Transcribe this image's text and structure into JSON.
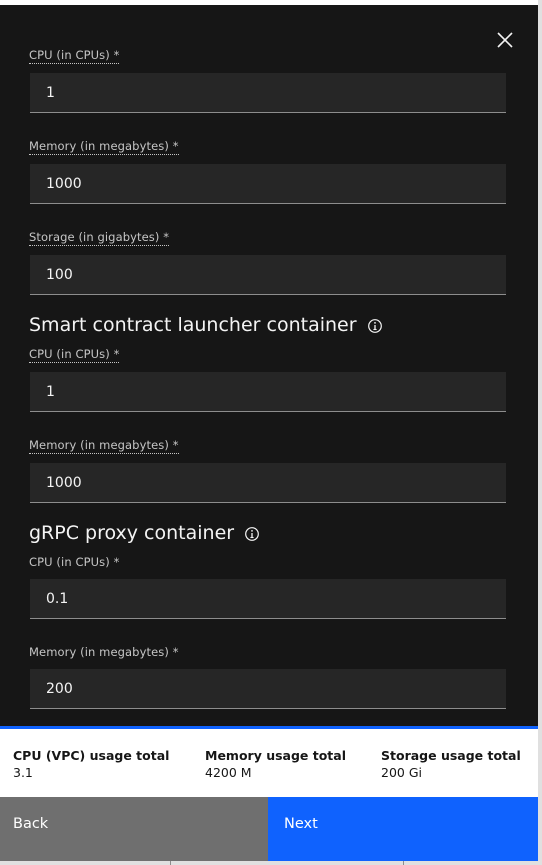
{
  "peer_container": {
    "cpu": {
      "label": "CPU (in CPUs) *",
      "value": "1"
    },
    "memory": {
      "label": "Memory (in megabytes) *",
      "value": "1000"
    },
    "storage": {
      "label": "Storage (in gigabytes) *",
      "value": "100"
    }
  },
  "chaincode_launcher": {
    "title": "Smart contract launcher container",
    "cpu": {
      "label": "CPU (in CPUs) *",
      "value": "1"
    },
    "memory": {
      "label": "Memory (in megabytes) *",
      "value": "1000"
    }
  },
  "grpc_proxy": {
    "title": "gRPC proxy container",
    "cpu": {
      "label": "CPU (in CPUs) *",
      "value": "0.1"
    },
    "memory": {
      "label": "Memory (in megabytes) *",
      "value": "200"
    }
  },
  "totals": {
    "cpu": {
      "label": "CPU (VPC) usage total",
      "value": "3.1"
    },
    "memory": {
      "label": "Memory usage total",
      "value": "4200 M"
    },
    "storage": {
      "label": "Storage usage total",
      "value": "200 Gi"
    }
  },
  "actions": {
    "back_label": "Back",
    "next_label": "Next"
  },
  "icons": {
    "close": "close-icon",
    "info": "information-icon"
  },
  "colors": {
    "panel_bg": "#161616",
    "field_bg": "#262626",
    "primary": "#0f62fe",
    "secondary": "#6f6f6f"
  }
}
